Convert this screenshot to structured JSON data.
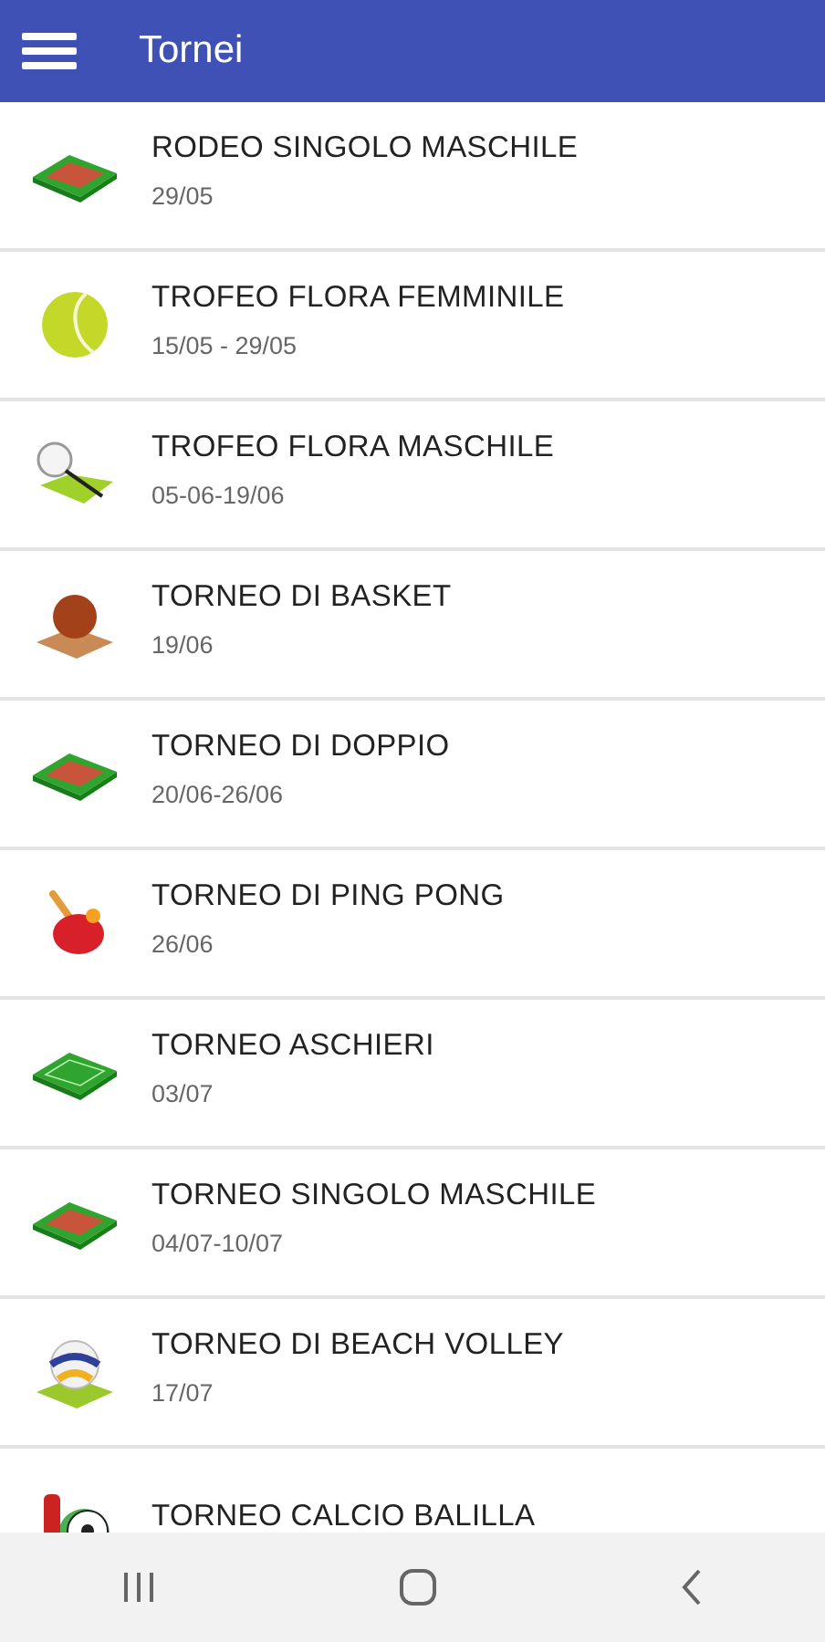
{
  "app_bar": {
    "title": "Tornei"
  },
  "tournaments": [
    {
      "name": "RODEO SINGOLO MASCHILE",
      "dates": "29/05",
      "kind": "clay-court"
    },
    {
      "name": "TROFEO FLORA FEMMINILE",
      "dates": "15/05 - 29/05",
      "kind": "tennis-ball"
    },
    {
      "name": "TROFEO FLORA MASCHILE",
      "dates": "05-06-19/06",
      "kind": "racket"
    },
    {
      "name": "TORNEO DI BASKET",
      "dates": "19/06",
      "kind": "basketball"
    },
    {
      "name": "TORNEO DI DOPPIO",
      "dates": "20/06-26/06",
      "kind": "clay-court"
    },
    {
      "name": "TORNEO DI PING PONG",
      "dates": "26/06",
      "kind": "ping-pong"
    },
    {
      "name": "TORNEO ASCHIERI",
      "dates": "03/07",
      "kind": "grass-court"
    },
    {
      "name": "TORNEO SINGOLO MASCHILE",
      "dates": "04/07-10/07",
      "kind": "clay-court"
    },
    {
      "name": "TORNEO DI BEACH VOLLEY",
      "dates": "17/07",
      "kind": "volleyball"
    },
    {
      "name": "TORNEO CALCIO BALILLA",
      "kind": "foosball"
    }
  ]
}
